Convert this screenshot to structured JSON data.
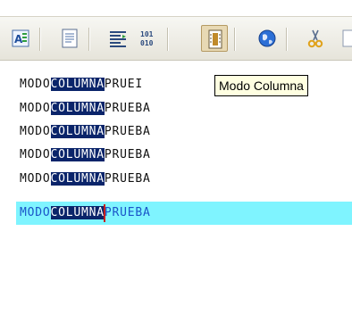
{
  "toolbar": {
    "buttons": [
      {
        "icon": "text-format-icon",
        "active": false
      },
      {
        "icon": "document-icon",
        "active": false
      },
      {
        "icon": "align-lines-icon",
        "active": false
      },
      {
        "icon": "binary-icon",
        "active": false,
        "glyph_top": "101",
        "glyph_bottom": "010"
      },
      {
        "icon": "column-mode-icon",
        "active": true
      },
      {
        "icon": "globe-icon",
        "active": false
      },
      {
        "icon": "scissors-icon",
        "active": false
      }
    ]
  },
  "tooltip": {
    "text": "Modo Columna"
  },
  "editor": {
    "lines": [
      {
        "before": "MODO",
        "selected": "COLUMNA",
        "after": "PRUEI"
      },
      {
        "before": "MODO",
        "selected": "COLUMNA",
        "after": "PRUEBA"
      },
      {
        "before": "MODO",
        "selected": "COLUMNA",
        "after": "PRUEBA"
      },
      {
        "before": "MODO",
        "selected": "COLUMNA",
        "after": "PRUEBA"
      },
      {
        "before": "MODO",
        "selected": "COLUMNA",
        "after": "PRUEBA"
      },
      {
        "before": "MODO",
        "selected": "COLUMNA",
        "after": "PRUEBA",
        "current": true
      }
    ]
  },
  "colors": {
    "selection": "#0a246a",
    "current_line": "#7ff4ff",
    "current_line_text": "#1a55c8",
    "caret": "#c81e1e",
    "tooltip_bg": "#ffffe1"
  }
}
